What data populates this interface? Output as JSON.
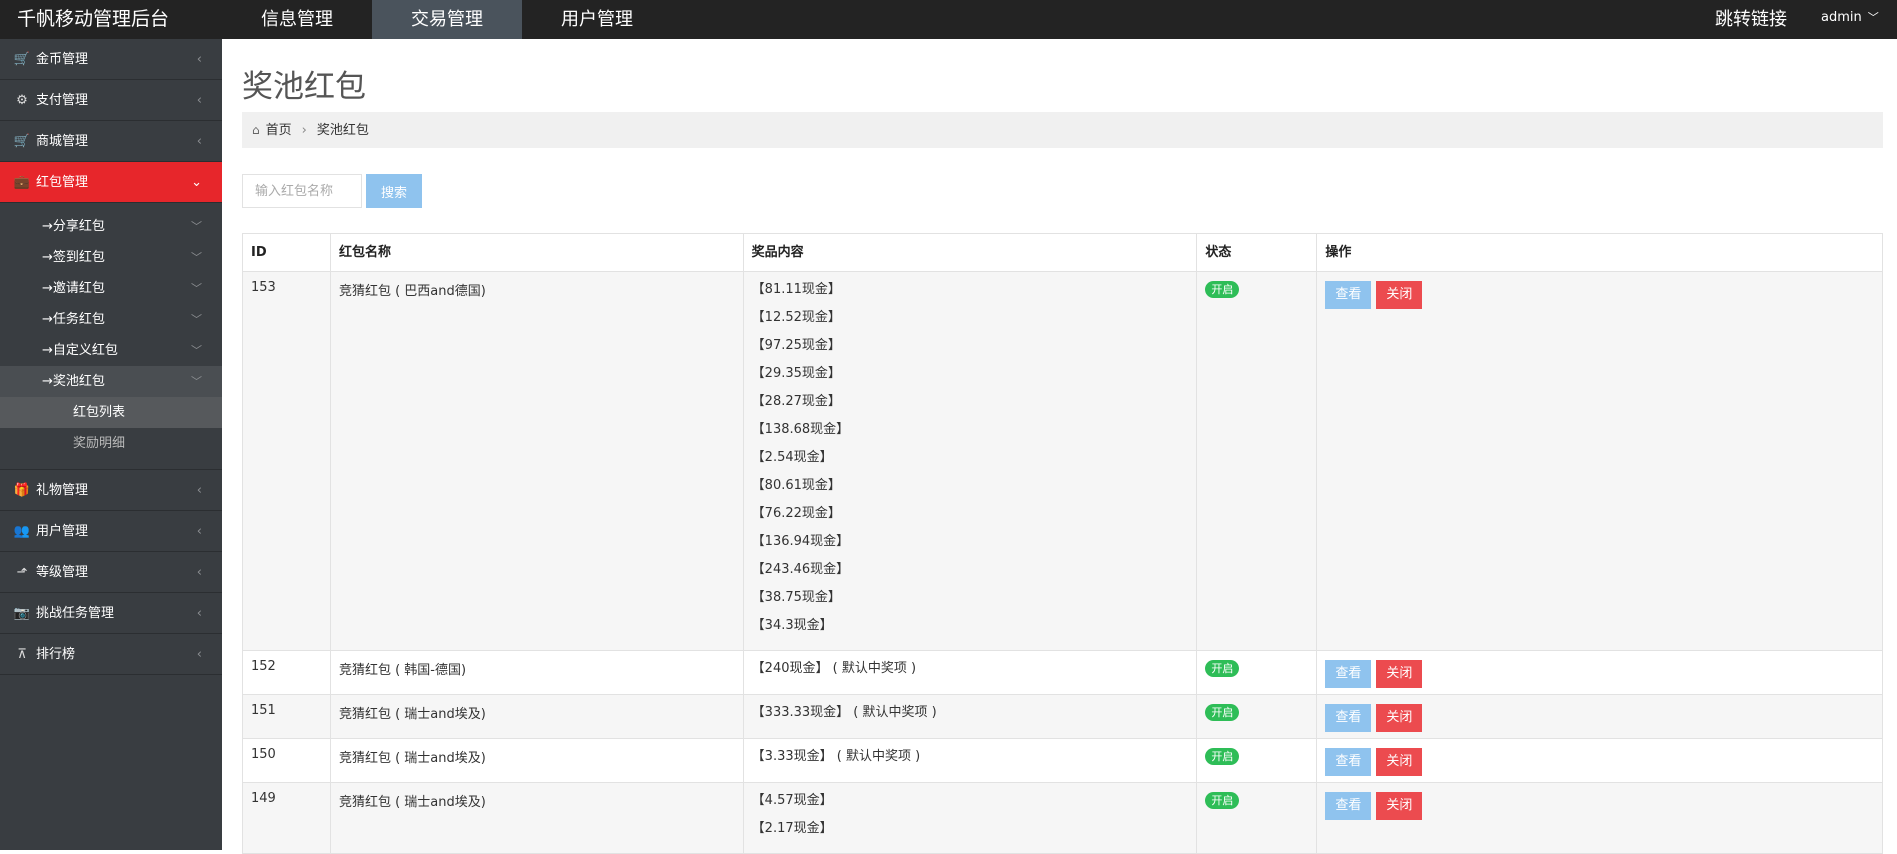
{
  "header": {
    "brand": "千帆移动管理后台",
    "nav": [
      "信息管理",
      "交易管理",
      "用户管理"
    ],
    "jump_link": "跳转链接",
    "user": "admin"
  },
  "sidebar": {
    "items": [
      {
        "icon": "cart-icon",
        "label": "金币管理"
      },
      {
        "icon": "gears-icon",
        "label": "支付管理"
      },
      {
        "icon": "shopping-cart-icon",
        "label": "商城管理"
      },
      {
        "icon": "briefcase-icon",
        "label": "红包管理"
      },
      {
        "icon": "gift-icon",
        "label": "礼物管理"
      },
      {
        "icon": "users-icon",
        "label": "用户管理"
      },
      {
        "icon": "level-up-icon",
        "label": "等级管理"
      },
      {
        "icon": "camera-icon",
        "label": "挑战任务管理"
      },
      {
        "icon": "sitemap-icon",
        "label": "排行榜"
      }
    ],
    "submenu": [
      "→分享红包",
      "→签到红包",
      "→邀请红包",
      "→任务红包",
      "→自定义红包",
      "→奖池红包"
    ],
    "subsubmenu": [
      "红包列表",
      "奖励明细"
    ]
  },
  "main": {
    "title": "奖池红包",
    "breadcrumb": {
      "home": "首页",
      "current": "奖池红包"
    },
    "search": {
      "placeholder": "输入红包名称",
      "button": "搜索"
    },
    "table": {
      "headers": [
        "ID",
        "红包名称",
        "奖品内容",
        "状态",
        "操作"
      ],
      "status_label": "开启",
      "view_label": "查看",
      "close_label": "关闭",
      "rows": [
        {
          "id": "153",
          "name": "竞猜红包 ( 巴西and德国)",
          "prizes": [
            "【81.11现金】",
            "【12.52现金】",
            "【97.25现金】",
            "【29.35现金】",
            "【28.27现金】",
            "【138.68现金】",
            "【2.54现金】",
            "【80.61现金】",
            "【76.22现金】",
            "【136.94现金】",
            "【243.46现金】",
            "【38.75现金】",
            "【34.3现金】"
          ]
        },
        {
          "id": "152",
          "name": "竞猜红包 ( 韩国-德国)",
          "prizes": [
            "【240现金】 ( 默认中奖项 )"
          ]
        },
        {
          "id": "151",
          "name": "竞猜红包 ( 瑞士and埃及)",
          "prizes": [
            "【333.33现金】 ( 默认中奖项 )"
          ]
        },
        {
          "id": "150",
          "name": "竞猜红包 ( 瑞士and埃及)",
          "prizes": [
            "【3.33现金】 ( 默认中奖项 )"
          ]
        },
        {
          "id": "149",
          "name": "竞猜红包 ( 瑞士and埃及)",
          "prizes": [
            "【4.57现金】",
            "【2.17现金】"
          ]
        }
      ]
    }
  }
}
